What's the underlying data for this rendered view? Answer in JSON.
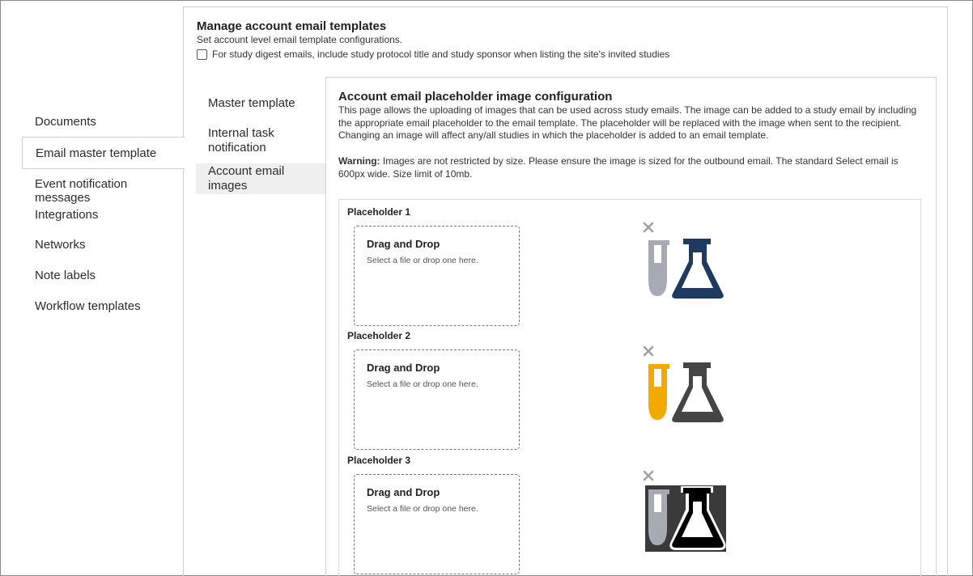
{
  "left_nav": {
    "items": [
      {
        "label": "Documents",
        "active": false
      },
      {
        "label": "Email master template",
        "active": true
      },
      {
        "label": "Event notification messages",
        "active": false
      },
      {
        "label": "Integrations",
        "active": false
      },
      {
        "label": "Networks",
        "active": false
      },
      {
        "label": "Note labels",
        "active": false
      },
      {
        "label": "Workflow templates",
        "active": false
      }
    ]
  },
  "main": {
    "title": "Manage account email templates",
    "subtitle": "Set account level email template configurations.",
    "digest_checkbox_label": "For study digest emails, include study protocol title and study sponsor when listing the site's invited studies",
    "digest_checked": false
  },
  "subtabs": [
    {
      "label": "Master template",
      "active": false
    },
    {
      "label": "Internal task notification",
      "active": false
    },
    {
      "label": "Account email images",
      "active": true
    }
  ],
  "content": {
    "title": "Account email placeholder image configuration",
    "description": "This page allows the uploading of images that can be used across study emails. The image can be added to a study email by including the appropriate email placeholder to the email template. The placeholder will be replaced with the image when sent to the recipient. Changing an image will affect any/all studies in which the placeholder is added to an email template.",
    "warning_label": "Warning:",
    "warning_text": " Images are not restricted by size. Please ensure the image is sized for the outbound email. The standard Select email is 600px wide. Size limit of 10mb."
  },
  "placeholders": [
    {
      "label": "Placeholder 1",
      "drop_title": "Drag and Drop",
      "drop_hint": "Select a file or drop one here.",
      "image": "lab-icons-blue",
      "tube_color": "#a6abb3",
      "flask_color": "#1f3a5f",
      "bg_color": "none"
    },
    {
      "label": "Placeholder 2",
      "drop_title": "Drag and Drop",
      "drop_hint": "Select a file or drop one here.",
      "image": "lab-icons-orange",
      "tube_color": "#f2a900",
      "flask_color": "#454545",
      "bg_color": "none"
    },
    {
      "label": "Placeholder 3",
      "drop_title": "Drag and Drop",
      "drop_hint": "Select a file or drop one here.",
      "image": "lab-icons-black",
      "tube_color": "#a6abb3",
      "flask_color": "#000000",
      "bg_color": "#3a3a3a"
    }
  ]
}
